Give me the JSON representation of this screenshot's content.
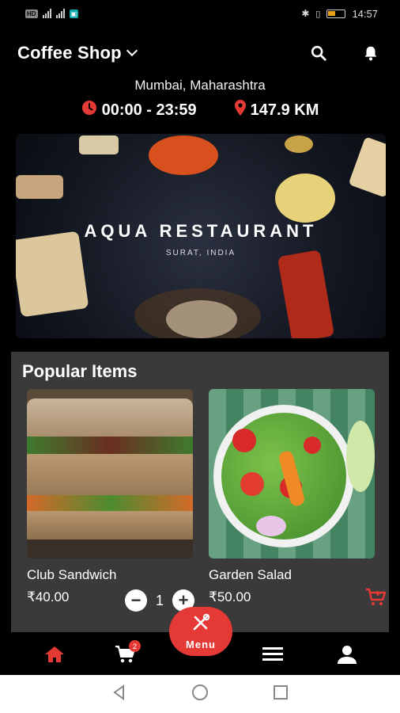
{
  "status_bar": {
    "time": "14:57",
    "indicators": [
      "sim-1",
      "sim-2",
      "wifi"
    ]
  },
  "header": {
    "title": "Coffee Shop",
    "search_icon": "search-icon",
    "notification_icon": "bell-icon"
  },
  "location": "Mumbai, Maharashtra",
  "hours": "00:00 - 23:59",
  "distance": "147.9 KM",
  "banner": {
    "title": "AQUA RESTAURANT",
    "subtitle": "SURAT, INDIA"
  },
  "popular": {
    "title": "Popular Items",
    "items": [
      {
        "name": "Club Sandwich",
        "price": "₹40.00",
        "quantity": "1",
        "minus": "−",
        "plus": "+"
      },
      {
        "name": "Garden Salad",
        "price": "₹50.00"
      }
    ]
  },
  "bottom_nav": {
    "items": [
      "home-icon",
      "cart-icon",
      "menu-list-icon",
      "profile-icon"
    ],
    "cart_count": "2",
    "fab_label": "Menu"
  },
  "colors": {
    "accent": "#e53935",
    "background": "#000000",
    "card": "#3a3a3a"
  }
}
